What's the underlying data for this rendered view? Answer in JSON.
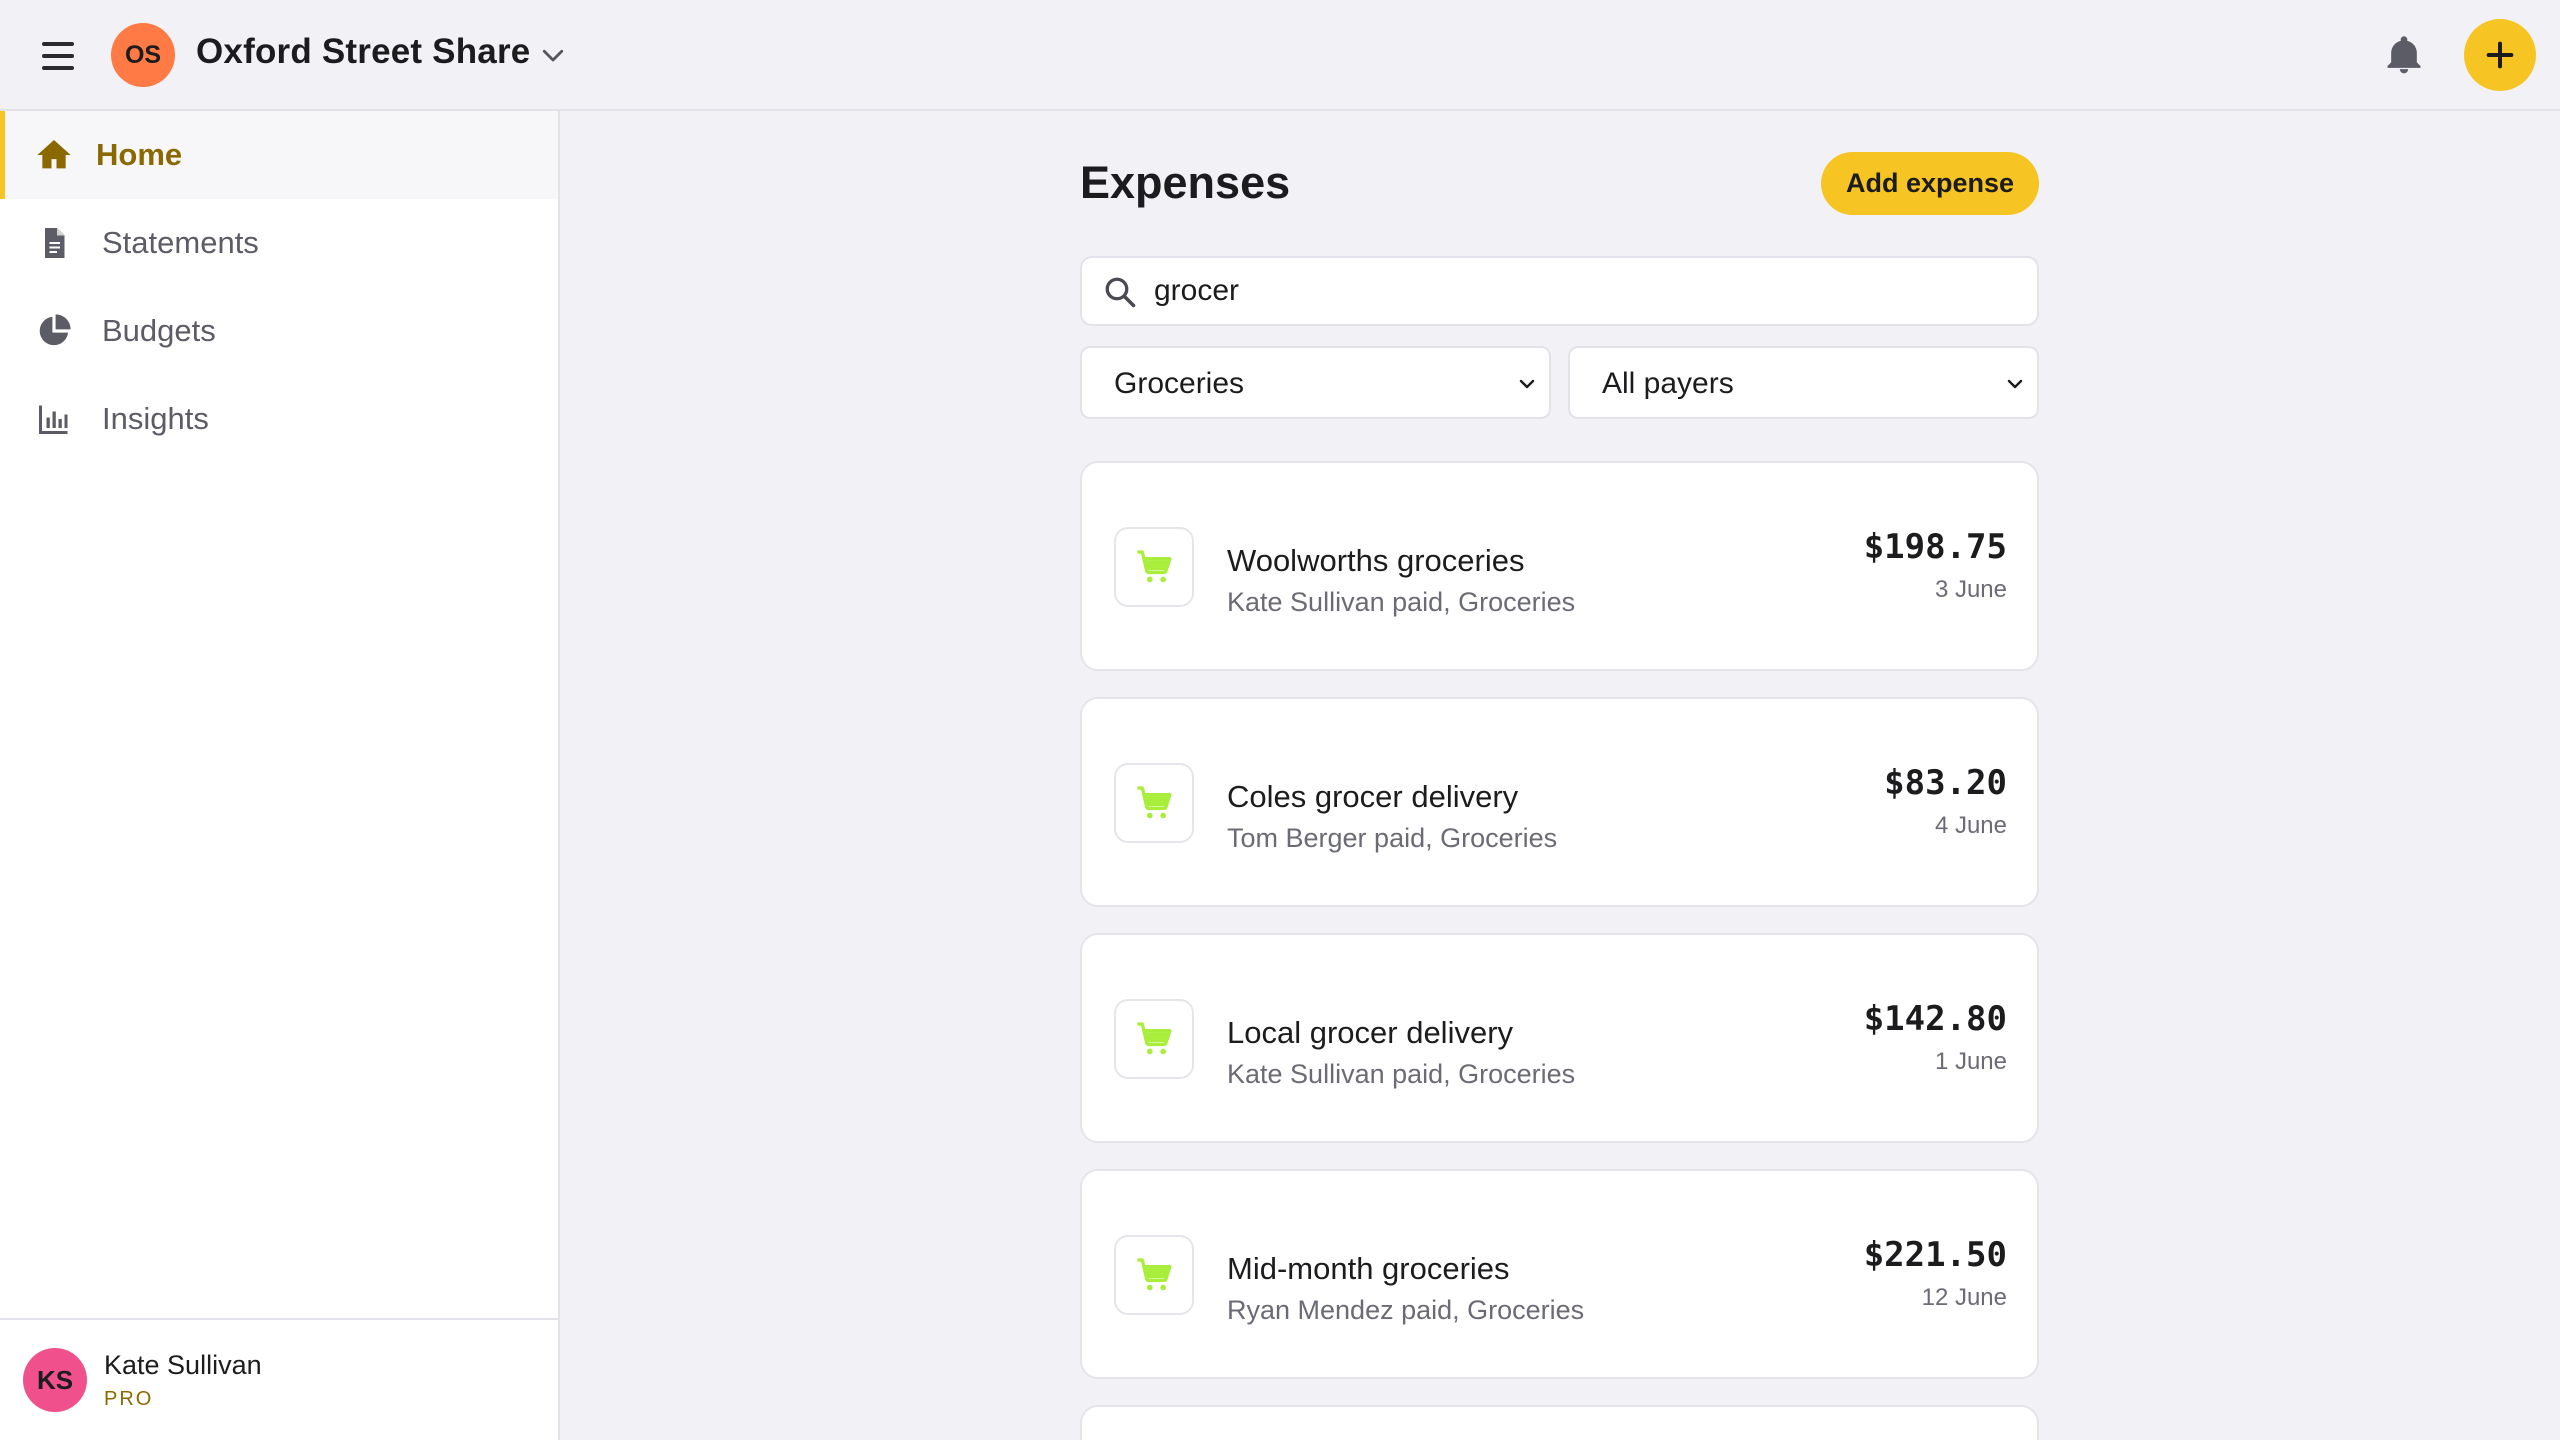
{
  "header": {
    "group_initials": "OS",
    "group_name": "Oxford Street Share"
  },
  "sidebar": {
    "items": [
      {
        "label": "Home",
        "icon": "home-icon",
        "active": true
      },
      {
        "label": "Statements",
        "icon": "document-icon",
        "active": false
      },
      {
        "label": "Budgets",
        "icon": "pie-chart-icon",
        "active": false
      },
      {
        "label": "Insights",
        "icon": "bar-chart-icon",
        "active": false
      }
    ],
    "user": {
      "initials": "KS",
      "name": "Kate Sullivan",
      "plan": "PRO"
    }
  },
  "main": {
    "title": "Expenses",
    "add_label": "Add expense",
    "search": {
      "value": "grocer"
    },
    "filters": {
      "category": "Groceries",
      "payer": "All payers"
    },
    "expenses": [
      {
        "title": "Woolworths groceries",
        "subtitle": "Kate Sullivan paid, Groceries",
        "amount": "$198.75",
        "date": "3 June"
      },
      {
        "title": "Coles grocer delivery",
        "subtitle": "Tom Berger paid, Groceries",
        "amount": "$83.20",
        "date": "4 June"
      },
      {
        "title": "Local grocer delivery",
        "subtitle": "Kate Sullivan paid, Groceries",
        "amount": "$142.80",
        "date": "1 June"
      },
      {
        "title": "Mid-month groceries",
        "subtitle": "Ryan Mendez paid, Groceries",
        "amount": "$221.50",
        "date": "12 June"
      }
    ]
  },
  "colors": {
    "accent": "#f6c423",
    "accent_text": "#8a6a00",
    "cart_icon": "#a8ee3a",
    "group_avatar": "#ff7a45",
    "user_avatar": "#f0508c"
  }
}
